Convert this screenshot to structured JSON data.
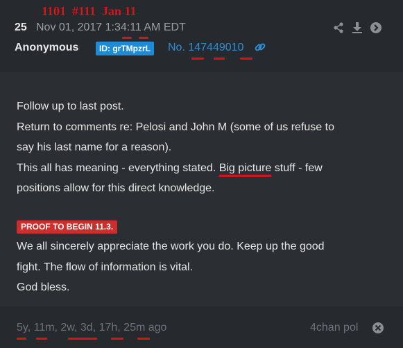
{
  "annotation": "1101  #111  Jan 11",
  "post": {
    "number": "25",
    "date": "Nov 01, 2017 1:34:11 AM EDT",
    "author": "Anonymous",
    "id_badge": "ID: grTMpzrL",
    "no_label": "No.",
    "no_value": "147449010"
  },
  "body": {
    "line1": "Follow up to last post.",
    "line2": "Return to comments re: Pelosi and John M (some of us refuse to",
    "line3": "say his last name for a reason).",
    "line4a": "This all has meaning - everything stated. ",
    "line4b": "Big picture",
    "line4c": " stuff - few",
    "line5": "positions allow for this direct knowledge.",
    "proof_badge": "PROOF TO BEGIN 11.3.",
    "line6": "We all sincerely appreciate the work you do. Keep up the good",
    "line7": "fight. The flow of information is vital.",
    "line8": "God bless."
  },
  "footer": {
    "age": "5y, 11m, 2w, 3d, 17h, 25m ago",
    "source": "4chan pol"
  },
  "icons": [
    "share-icon",
    "download-icon",
    "forward-icon",
    "link-icon",
    "close-icon"
  ],
  "colors": {
    "accent_blue": "#2d8fd7",
    "annotation_red": "#d4151b",
    "proof_red": "#c9302c"
  }
}
